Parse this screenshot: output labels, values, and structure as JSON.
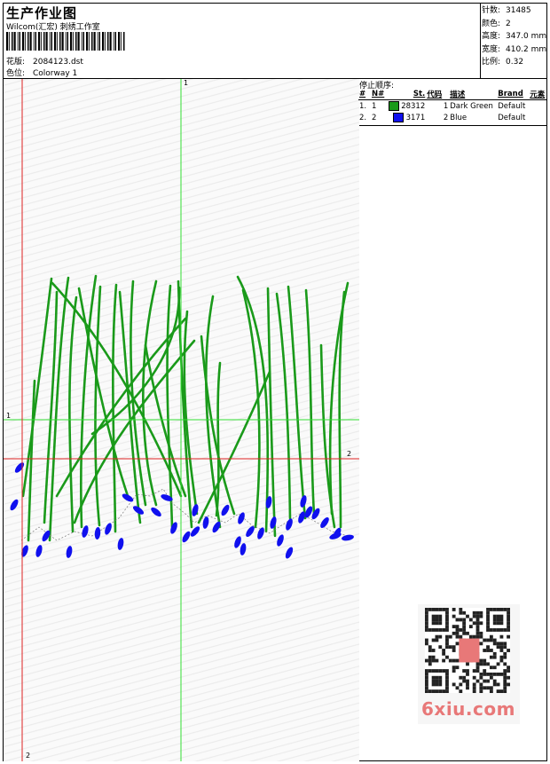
{
  "header": {
    "title": "生产作业图",
    "company": "Wilcom(汇宏) 刺绣工作室",
    "design_label": "花版:",
    "design_value": "2084123.dst",
    "colorway_label": "色位:",
    "colorway_value": "Colorway 1"
  },
  "stats": {
    "stitches_label": "针数:",
    "stitches_value": "31485",
    "colors_label": "颜色:",
    "colors_value": "2",
    "height_label": "高度:",
    "height_value": "347.0 mm",
    "width_label": "宽度:",
    "width_value": "410.2 mm",
    "scale_label": "比例:",
    "scale_value": "0.32"
  },
  "stop_sequence": {
    "label": "停止顺序:",
    "columns": [
      "#",
      "N#",
      "St.",
      "代码",
      "描述",
      "Brand",
      "元素"
    ],
    "rows": [
      {
        "index": "1.",
        "needle": "1",
        "color": "#1a9a1a",
        "stitches": "28312",
        "code": "1",
        "description": "Dark Green",
        "brand": "Default"
      },
      {
        "index": "2.",
        "needle": "2",
        "color": "#1010ee",
        "stitches": "3171",
        "code": "2",
        "description": "Blue",
        "brand": "Default"
      }
    ]
  },
  "guides": {
    "green_v_label": "1",
    "green_h_label": "1",
    "red_h_label": "2",
    "red_v_label": "2"
  },
  "colors": {
    "thread_green": "#1a9a1a",
    "thread_blue": "#1010ee",
    "guide_green": "#33dd33",
    "guide_red": "#dd2222",
    "watermark": "#e87878"
  },
  "watermark": {
    "text": "6xiu.com"
  }
}
